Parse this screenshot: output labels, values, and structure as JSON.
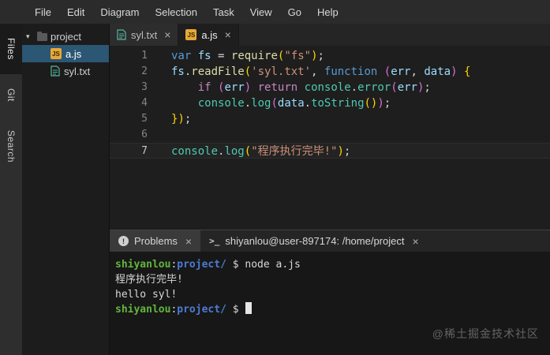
{
  "menu": {
    "items": [
      "File",
      "Edit",
      "Diagram",
      "Selection",
      "Task",
      "View",
      "Go",
      "Help"
    ]
  },
  "activity_bar": {
    "items": [
      {
        "label": "Files",
        "active": true
      },
      {
        "label": "Git",
        "active": false
      },
      {
        "label": "Search",
        "active": false
      }
    ]
  },
  "explorer": {
    "folder_label": "project",
    "files": [
      {
        "label": "a.js",
        "icon": "js",
        "selected": true
      },
      {
        "label": "syl.txt",
        "icon": "txt",
        "selected": false
      }
    ]
  },
  "editor": {
    "tabs": [
      {
        "label": "syl.txt",
        "icon": "txt",
        "active": false,
        "close": "×"
      },
      {
        "label": "a.js",
        "icon": "js",
        "active": true,
        "close": "×"
      }
    ],
    "current_line": 7,
    "code_lines": [
      {
        "num": 1,
        "tokens": [
          {
            "c": "kw",
            "t": "var"
          },
          {
            "c": "plain",
            "t": " "
          },
          {
            "c": "vr",
            "t": "fs"
          },
          {
            "c": "plain",
            "t": " = "
          },
          {
            "c": "fn",
            "t": "require"
          },
          {
            "c": "p1",
            "t": "("
          },
          {
            "c": "str",
            "t": "\"fs\""
          },
          {
            "c": "p1",
            "t": ")"
          },
          {
            "c": "plain",
            "t": ";"
          }
        ]
      },
      {
        "num": 2,
        "tokens": [
          {
            "c": "vr",
            "t": "fs"
          },
          {
            "c": "plain",
            "t": "."
          },
          {
            "c": "fn",
            "t": "readFile"
          },
          {
            "c": "p1",
            "t": "("
          },
          {
            "c": "str",
            "t": "'syl.txt'"
          },
          {
            "c": "plain",
            "t": ", "
          },
          {
            "c": "kw",
            "t": "function"
          },
          {
            "c": "plain",
            "t": " "
          },
          {
            "c": "p2",
            "t": "("
          },
          {
            "c": "vr",
            "t": "err"
          },
          {
            "c": "plain",
            "t": ", "
          },
          {
            "c": "vr",
            "t": "data"
          },
          {
            "c": "p2",
            "t": ")"
          },
          {
            "c": "plain",
            "t": " "
          },
          {
            "c": "p1",
            "t": "{"
          }
        ]
      },
      {
        "num": 3,
        "tokens": [
          {
            "c": "plain",
            "t": "    "
          },
          {
            "c": "ctrl",
            "t": "if"
          },
          {
            "c": "plain",
            "t": " "
          },
          {
            "c": "p2",
            "t": "("
          },
          {
            "c": "vr",
            "t": "err"
          },
          {
            "c": "p2",
            "t": ")"
          },
          {
            "c": "plain",
            "t": " "
          },
          {
            "c": "ctrl",
            "t": "return"
          },
          {
            "c": "plain",
            "t": " "
          },
          {
            "c": "cls",
            "t": "console"
          },
          {
            "c": "plain",
            "t": "."
          },
          {
            "c": "cls",
            "t": "error"
          },
          {
            "c": "p2",
            "t": "("
          },
          {
            "c": "vr",
            "t": "err"
          },
          {
            "c": "p2",
            "t": ")"
          },
          {
            "c": "plain",
            "t": ";"
          }
        ]
      },
      {
        "num": 4,
        "tokens": [
          {
            "c": "plain",
            "t": "    "
          },
          {
            "c": "cls",
            "t": "console"
          },
          {
            "c": "plain",
            "t": "."
          },
          {
            "c": "cls",
            "t": "log"
          },
          {
            "c": "p2",
            "t": "("
          },
          {
            "c": "vr",
            "t": "data"
          },
          {
            "c": "plain",
            "t": "."
          },
          {
            "c": "cls",
            "t": "toString"
          },
          {
            "c": "p1",
            "t": "()"
          },
          {
            "c": "p2",
            "t": ")"
          },
          {
            "c": "plain",
            "t": ";"
          }
        ]
      },
      {
        "num": 5,
        "tokens": [
          {
            "c": "p1",
            "t": "}"
          },
          {
            "c": "p1",
            "t": ")"
          },
          {
            "c": "plain",
            "t": ";"
          }
        ]
      },
      {
        "num": 6,
        "tokens": []
      },
      {
        "num": 7,
        "tokens": [
          {
            "c": "cls",
            "t": "console"
          },
          {
            "c": "plain",
            "t": "."
          },
          {
            "c": "cls",
            "t": "log"
          },
          {
            "c": "p1",
            "t": "("
          },
          {
            "c": "str",
            "t": "\"程序执行完毕!\""
          },
          {
            "c": "p1",
            "t": ")"
          },
          {
            "c": "plain",
            "t": ";"
          }
        ]
      }
    ]
  },
  "panel": {
    "tabs": [
      {
        "label": "Problems",
        "icon": "problems",
        "close": "×"
      },
      {
        "label": "shiyanlou@user-897174: /home/project",
        "icon": "terminal",
        "close": "×"
      }
    ],
    "problems_badge": "!",
    "terminal_glyph": ">_",
    "terminal_lines": [
      {
        "cursor": false,
        "segments": [
          {
            "c": "green",
            "b": true,
            "t": "shiyanlou"
          },
          {
            "c": "fg",
            "b": false,
            "t": ":"
          },
          {
            "c": "blue",
            "b": true,
            "t": "project/"
          },
          {
            "c": "fg",
            "b": false,
            "t": " $ node a.js"
          }
        ]
      },
      {
        "cursor": false,
        "segments": [
          {
            "c": "fg",
            "b": false,
            "t": "程序执行完毕!"
          }
        ]
      },
      {
        "cursor": false,
        "segments": [
          {
            "c": "fg",
            "b": false,
            "t": "hello syl!"
          }
        ]
      },
      {
        "cursor": true,
        "segments": [
          {
            "c": "green",
            "b": true,
            "t": "shiyanlou"
          },
          {
            "c": "fg",
            "b": false,
            "t": ":"
          },
          {
            "c": "blue",
            "b": true,
            "t": "project/"
          },
          {
            "c": "fg",
            "b": false,
            "t": " $ "
          }
        ]
      }
    ]
  },
  "watermark": {
    "text": "@稀土掘金技术社区"
  },
  "icons": {
    "js_label": "JS"
  },
  "colors": {
    "kw": "#569cd6",
    "ctrl": "#c586c0",
    "vr": "#9cdcfe",
    "fn": "#dcdcaa",
    "cls": "#4ec9b0",
    "str": "#ce9178",
    "plain": "#d4d4d4",
    "p1": "#ffd700",
    "p2": "#da70d6",
    "green": "#62b53e",
    "blue": "#4d7ad1",
    "fg": "#d8d8d8",
    "selection_bg": "#2b5674",
    "js_badge_bg": "#e8a838"
  }
}
